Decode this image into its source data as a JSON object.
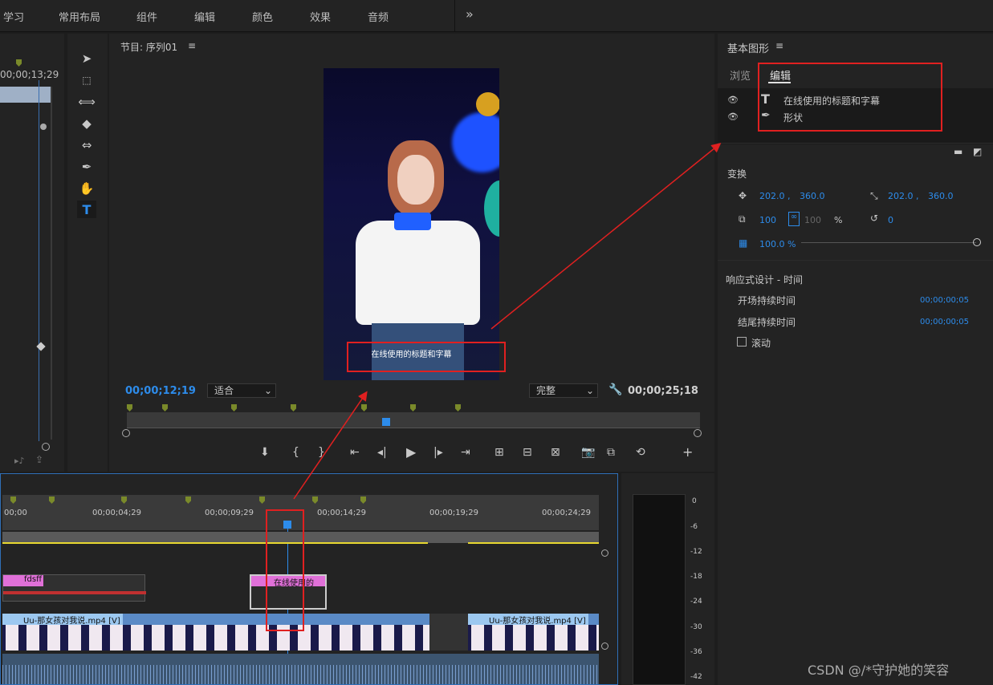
{
  "workspaces": [
    "学习",
    "常用布局",
    "组件",
    "编辑",
    "颜色",
    "效果",
    "音频"
  ],
  "workspace_more": "»",
  "source_timecode": "00;00;13;29",
  "program": {
    "title": "节目: 序列01",
    "menu": "≡",
    "timecode_current": "00;00;12;19",
    "timecode_duration": "00;00;25;18",
    "fit": "适合",
    "quality": "完整",
    "caption": "在线使用的标题和字幕"
  },
  "essential": {
    "title": "基本图形",
    "menu": "≡",
    "tabs": [
      "浏览",
      "编辑"
    ],
    "layers": [
      {
        "label": "在线使用的标题和字幕",
        "icon": "text-icon"
      },
      {
        "label": "形状",
        "icon": "pen-icon"
      }
    ],
    "transform_label": "变换",
    "pos_x": "202.0 ,",
    "pos_y": "360.0",
    "anchor_x": "202.0 ,",
    "anchor_y": "360.0",
    "scale": "100",
    "scale2": "100",
    "percent": "%",
    "rotation": "0",
    "opacity": "100.0 %",
    "responsive_label": "响应式设计 - 时间",
    "intro_label": "开场持续时间",
    "intro_value": "00;00;00;05",
    "outro_label": "结尾持续时间",
    "outro_value": "00;00;00;05",
    "scroll_label": "滚动"
  },
  "timeline": {
    "ruler": [
      "00;00",
      "00;00;04;29",
      "00;00;09;29",
      "00;00;14;29",
      "00;00;19;29",
      "00;00;24;29"
    ],
    "clip_fx1": "fdsff",
    "clip_fx2": "在线使用的",
    "video_clip1": "Uu-那女孩对我说.mp4 [V]",
    "video_clip2": "Uu-那女孩对我说.mp4 [V]"
  },
  "meter": [
    "0",
    "-6",
    "-12",
    "-18",
    "-24",
    "-30",
    "-36",
    "-42"
  ],
  "watermark": "CSDN @/*守护她的笑容"
}
